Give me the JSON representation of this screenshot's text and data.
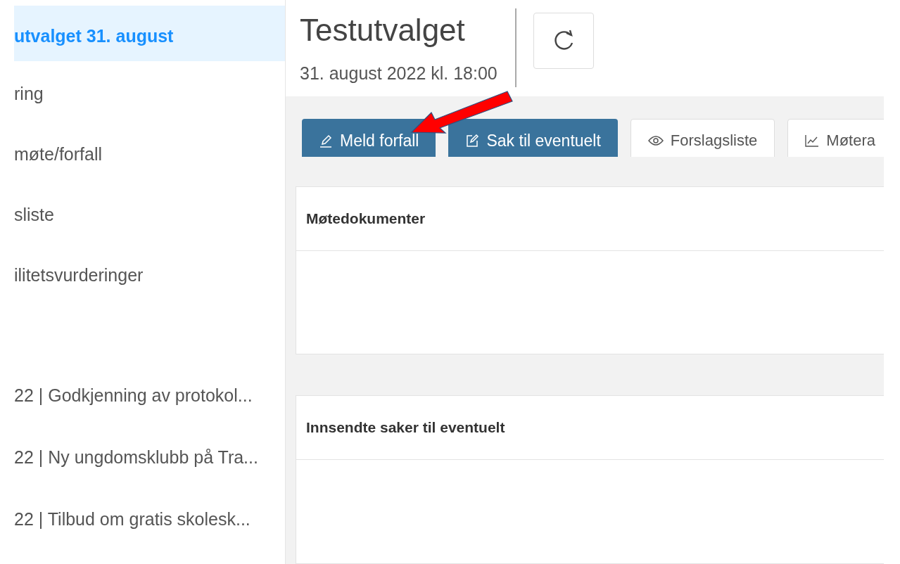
{
  "sidebar": {
    "items": [
      {
        "label": "utvalget 31. august",
        "selected": true
      },
      {
        "label": "ring",
        "selected": false
      },
      {
        "label": "møte/forfall",
        "selected": false
      },
      {
        "label": "sliste",
        "selected": false
      },
      {
        "label": "ilitetsvurderinger",
        "selected": false
      }
    ],
    "cases": [
      {
        "label": "22 | Godkjenning av protokol...",
        "selected": false
      },
      {
        "label": "22 | Ny ungdomsklubb på Tra...",
        "selected": false
      },
      {
        "label": "22 | Tilbud om gratis skolesk...",
        "selected": false
      }
    ]
  },
  "header": {
    "title": "Testutvalget",
    "date": "31. august 2022 kl. 18:00"
  },
  "toolbar": [
    {
      "label": "Meld forfall",
      "kind": "primary"
    },
    {
      "label": "Sak til eventuelt",
      "kind": "primary"
    },
    {
      "label": "Forslagsliste",
      "kind": "default"
    },
    {
      "label": "Møtera",
      "kind": "default"
    }
  ],
  "panels": [
    {
      "title": "Møtedokumenter"
    },
    {
      "title": "Innsendte saker til eventuelt"
    }
  ]
}
